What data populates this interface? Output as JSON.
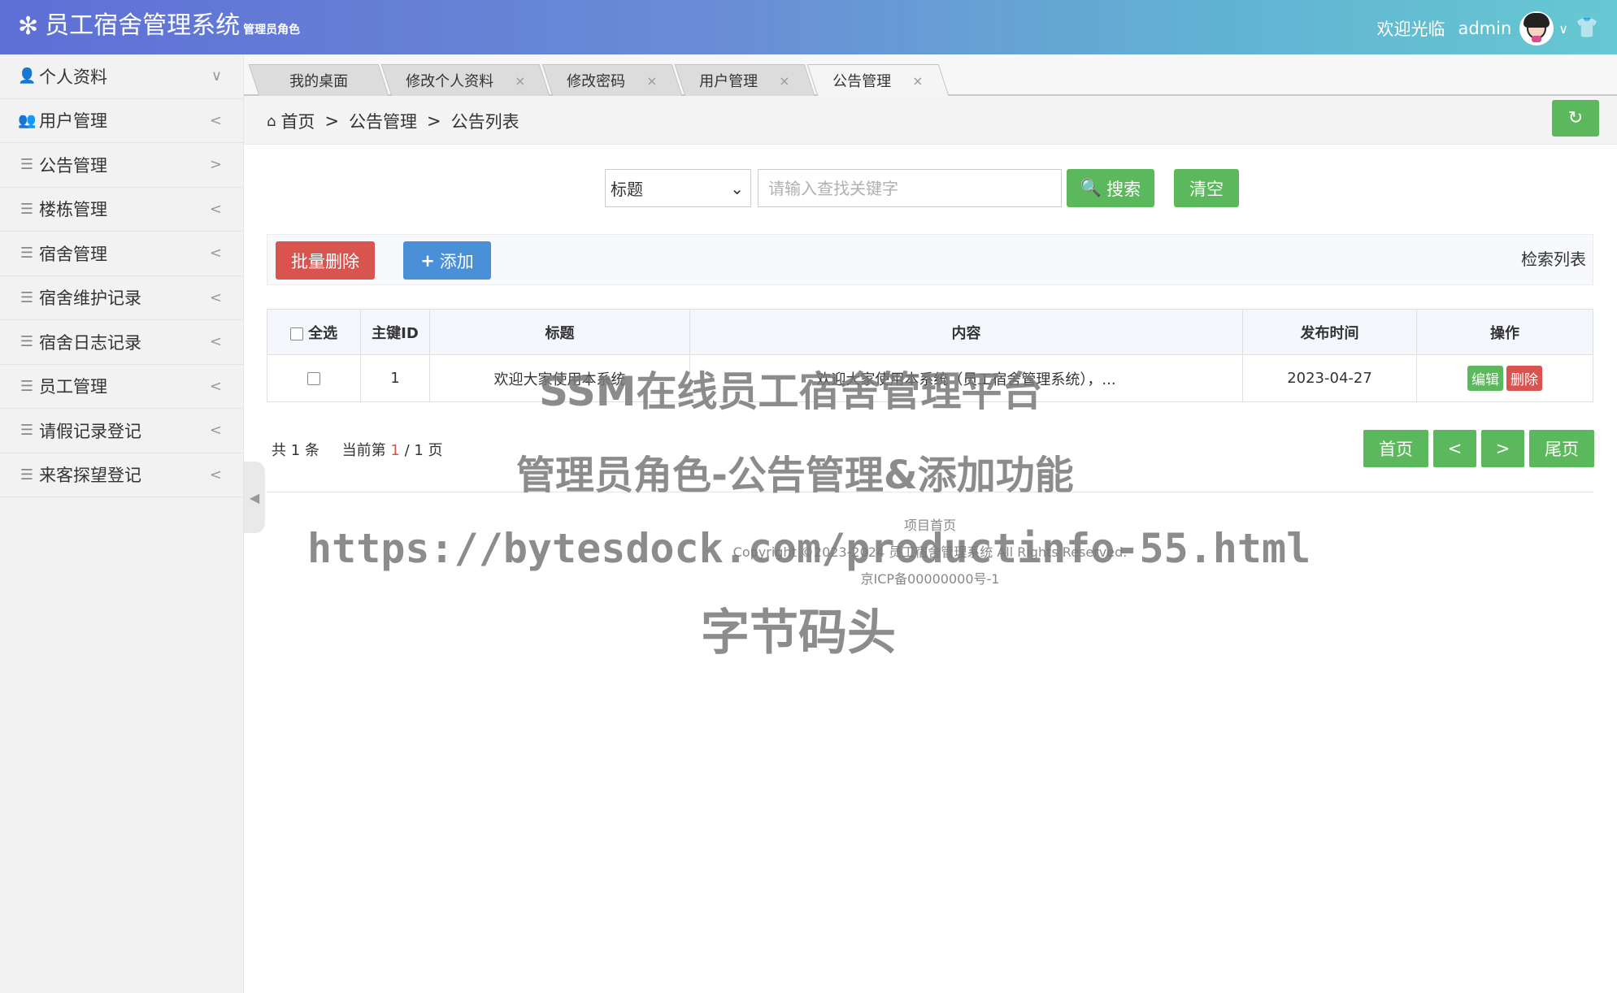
{
  "header": {
    "app_title": "员工宿舍管理系统",
    "role": "管理员角色",
    "welcome": "欢迎光临",
    "username": "admin",
    "gradient_colors": [
      "#5e6fd6",
      "#66c8d2"
    ]
  },
  "sidebar": {
    "items": [
      {
        "label": "个人资料",
        "icon": "user-icon",
        "arrow": "∨"
      },
      {
        "label": "用户管理",
        "icon": "users-icon",
        "arrow": "<"
      },
      {
        "label": "公告管理",
        "icon": "list-icon",
        "arrow": ">"
      },
      {
        "label": "楼栋管理",
        "icon": "list-icon",
        "arrow": "<"
      },
      {
        "label": "宿舍管理",
        "icon": "list-icon",
        "arrow": "<"
      },
      {
        "label": "宿舍维护记录",
        "icon": "list-icon",
        "arrow": "<"
      },
      {
        "label": "宿舍日志记录",
        "icon": "list-icon",
        "arrow": "<"
      },
      {
        "label": "员工管理",
        "icon": "list-icon",
        "arrow": "<"
      },
      {
        "label": "请假记录登记",
        "icon": "list-icon",
        "arrow": "<"
      },
      {
        "label": "来客探望登记",
        "icon": "list-icon",
        "arrow": "<"
      }
    ]
  },
  "tabs": [
    {
      "label": "我的桌面",
      "closable": false,
      "active": false
    },
    {
      "label": "修改个人资料",
      "closable": true,
      "active": false
    },
    {
      "label": "修改密码",
      "closable": true,
      "active": false
    },
    {
      "label": "用户管理",
      "closable": true,
      "active": false
    },
    {
      "label": "公告管理",
      "closable": true,
      "active": true
    }
  ],
  "breadcrumb": {
    "home": "首页",
    "sep": ">",
    "section": "公告管理",
    "page": "公告列表"
  },
  "search": {
    "field_selected": "标题",
    "placeholder": "请输入查找关键字",
    "search_label": "搜索",
    "clear_label": "清空"
  },
  "actions": {
    "batch_delete": "批量删除",
    "add": "添加",
    "list_title": "检索列表"
  },
  "table": {
    "headers": {
      "select_all": "全选",
      "id": "主键ID",
      "title": "标题",
      "content": "内容",
      "time": "发布时间",
      "ops": "操作"
    },
    "rows": [
      {
        "id": "1",
        "title": "欢迎大家使用本系统",
        "content": "欢迎大家使用本系统（员工宿舍管理系统），...",
        "time": "2023-04-27",
        "edit": "编辑",
        "delete": "删除"
      }
    ]
  },
  "pagination": {
    "total_prefix": "共",
    "total": "1",
    "total_suffix": "条",
    "current_prefix": "当前第",
    "current": "1",
    "slash": " / ",
    "pages": "1",
    "pages_suffix": "页",
    "first": "首页",
    "prev": "<",
    "next": ">",
    "last": "尾页"
  },
  "footer": {
    "home_link": "项目首页",
    "copyright": "Copyright ©2023-2024 员工宿舍管理系统 All Rights Reserved.",
    "icp": "京ICP备00000000号-1"
  },
  "watermark": {
    "line1": "SSM在线员工宿舍管理平台",
    "line2": "管理员角色-公告管理&添加功能",
    "line3": "https://bytesdock.com/productinfo-55.html",
    "line4": "字节码头"
  },
  "colors": {
    "green": "#5cb85c",
    "red": "#d9534f",
    "blue": "#4a90d9"
  }
}
